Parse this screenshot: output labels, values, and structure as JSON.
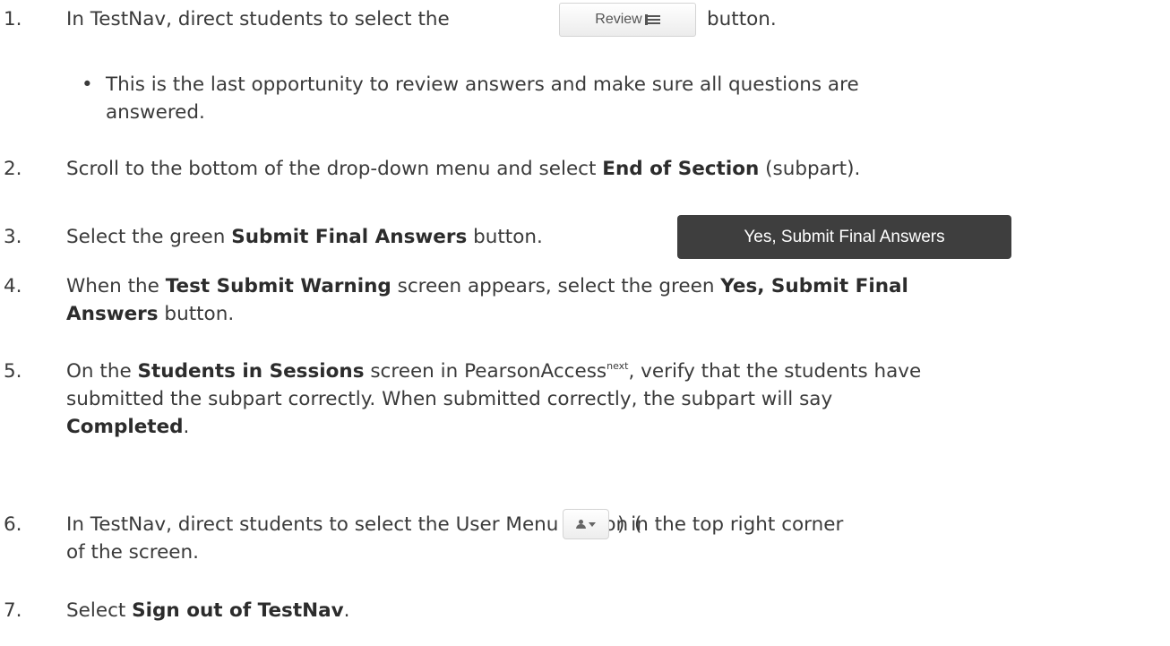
{
  "steps": [
    {
      "num": "1.",
      "text": "In TestNav, direct students to select the",
      "after": "button."
    },
    {
      "num": "2.",
      "pre": "Scroll to the bottom of the drop-down menu and select ",
      "bold": "End of Section",
      "post": " (subpart)."
    },
    {
      "num": "3.",
      "pre": "Select the green ",
      "bold": "Submit Final Answers",
      "post": " button."
    },
    {
      "num": "4.",
      "line1_pre": "When the ",
      "line1_bold1": "Test Submit Warning",
      "line1_mid": " screen appears, select the green ",
      "line1_bold2": "Yes, Submit Final",
      "line2_bold": "Answers",
      "line2_post": " button."
    },
    {
      "num": "5.",
      "line1_pre": "On the ",
      "line1_bold": "Students in Sessions",
      "line1_mid": " screen in PearsonAccess",
      "line1_sup": "next",
      "line1_post": ", verify that the students have",
      "line2": "submitted the subpart correctly. When submitted correctly, the subpart will say",
      "line3_bold": "Completed",
      "line3_post": "."
    },
    {
      "num": "6.",
      "line1_pre": "In TestNav, direct students to select the User Menu button (",
      "line1_post": ") in the top right corner",
      "line2": "of the screen."
    },
    {
      "num": "7.",
      "pre": "Select ",
      "bold": "Sign out of TestNav",
      "post": "."
    }
  ],
  "bullet": {
    "symbol": "•",
    "line1": "This is the last opportunity to review answers and make sure all questions are",
    "line2": "answered."
  },
  "buttons": {
    "review_label": "Review",
    "review_icon": "list-icon",
    "submit_label": "Yes, Submit Final Answers",
    "user_menu_icon": "user-icon"
  }
}
